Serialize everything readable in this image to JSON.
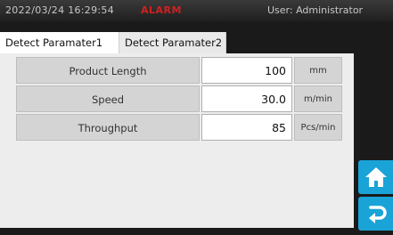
{
  "status_bar": {
    "datetime": "2022/03/24 16:29:54",
    "alarm": "ALARM",
    "user": "User: Administrator"
  },
  "tabs": [
    {
      "label": "Detect Paramater1",
      "active": true
    },
    {
      "label": "Detect Paramater2",
      "active": false
    }
  ],
  "parameters": [
    {
      "name": "Product Length",
      "value": "100",
      "unit": "mm"
    },
    {
      "name": "Speed",
      "value": "30.0",
      "unit": "m/min"
    },
    {
      "name": "Throughput",
      "value": "85",
      "unit": "Pcs/min"
    }
  ],
  "side_buttons": {
    "home_icon": "home-icon",
    "back_icon": "return-arrow-icon"
  },
  "colors": {
    "accent": "#1aa3d6",
    "alarm": "#d02020",
    "panel": "#ededed"
  }
}
